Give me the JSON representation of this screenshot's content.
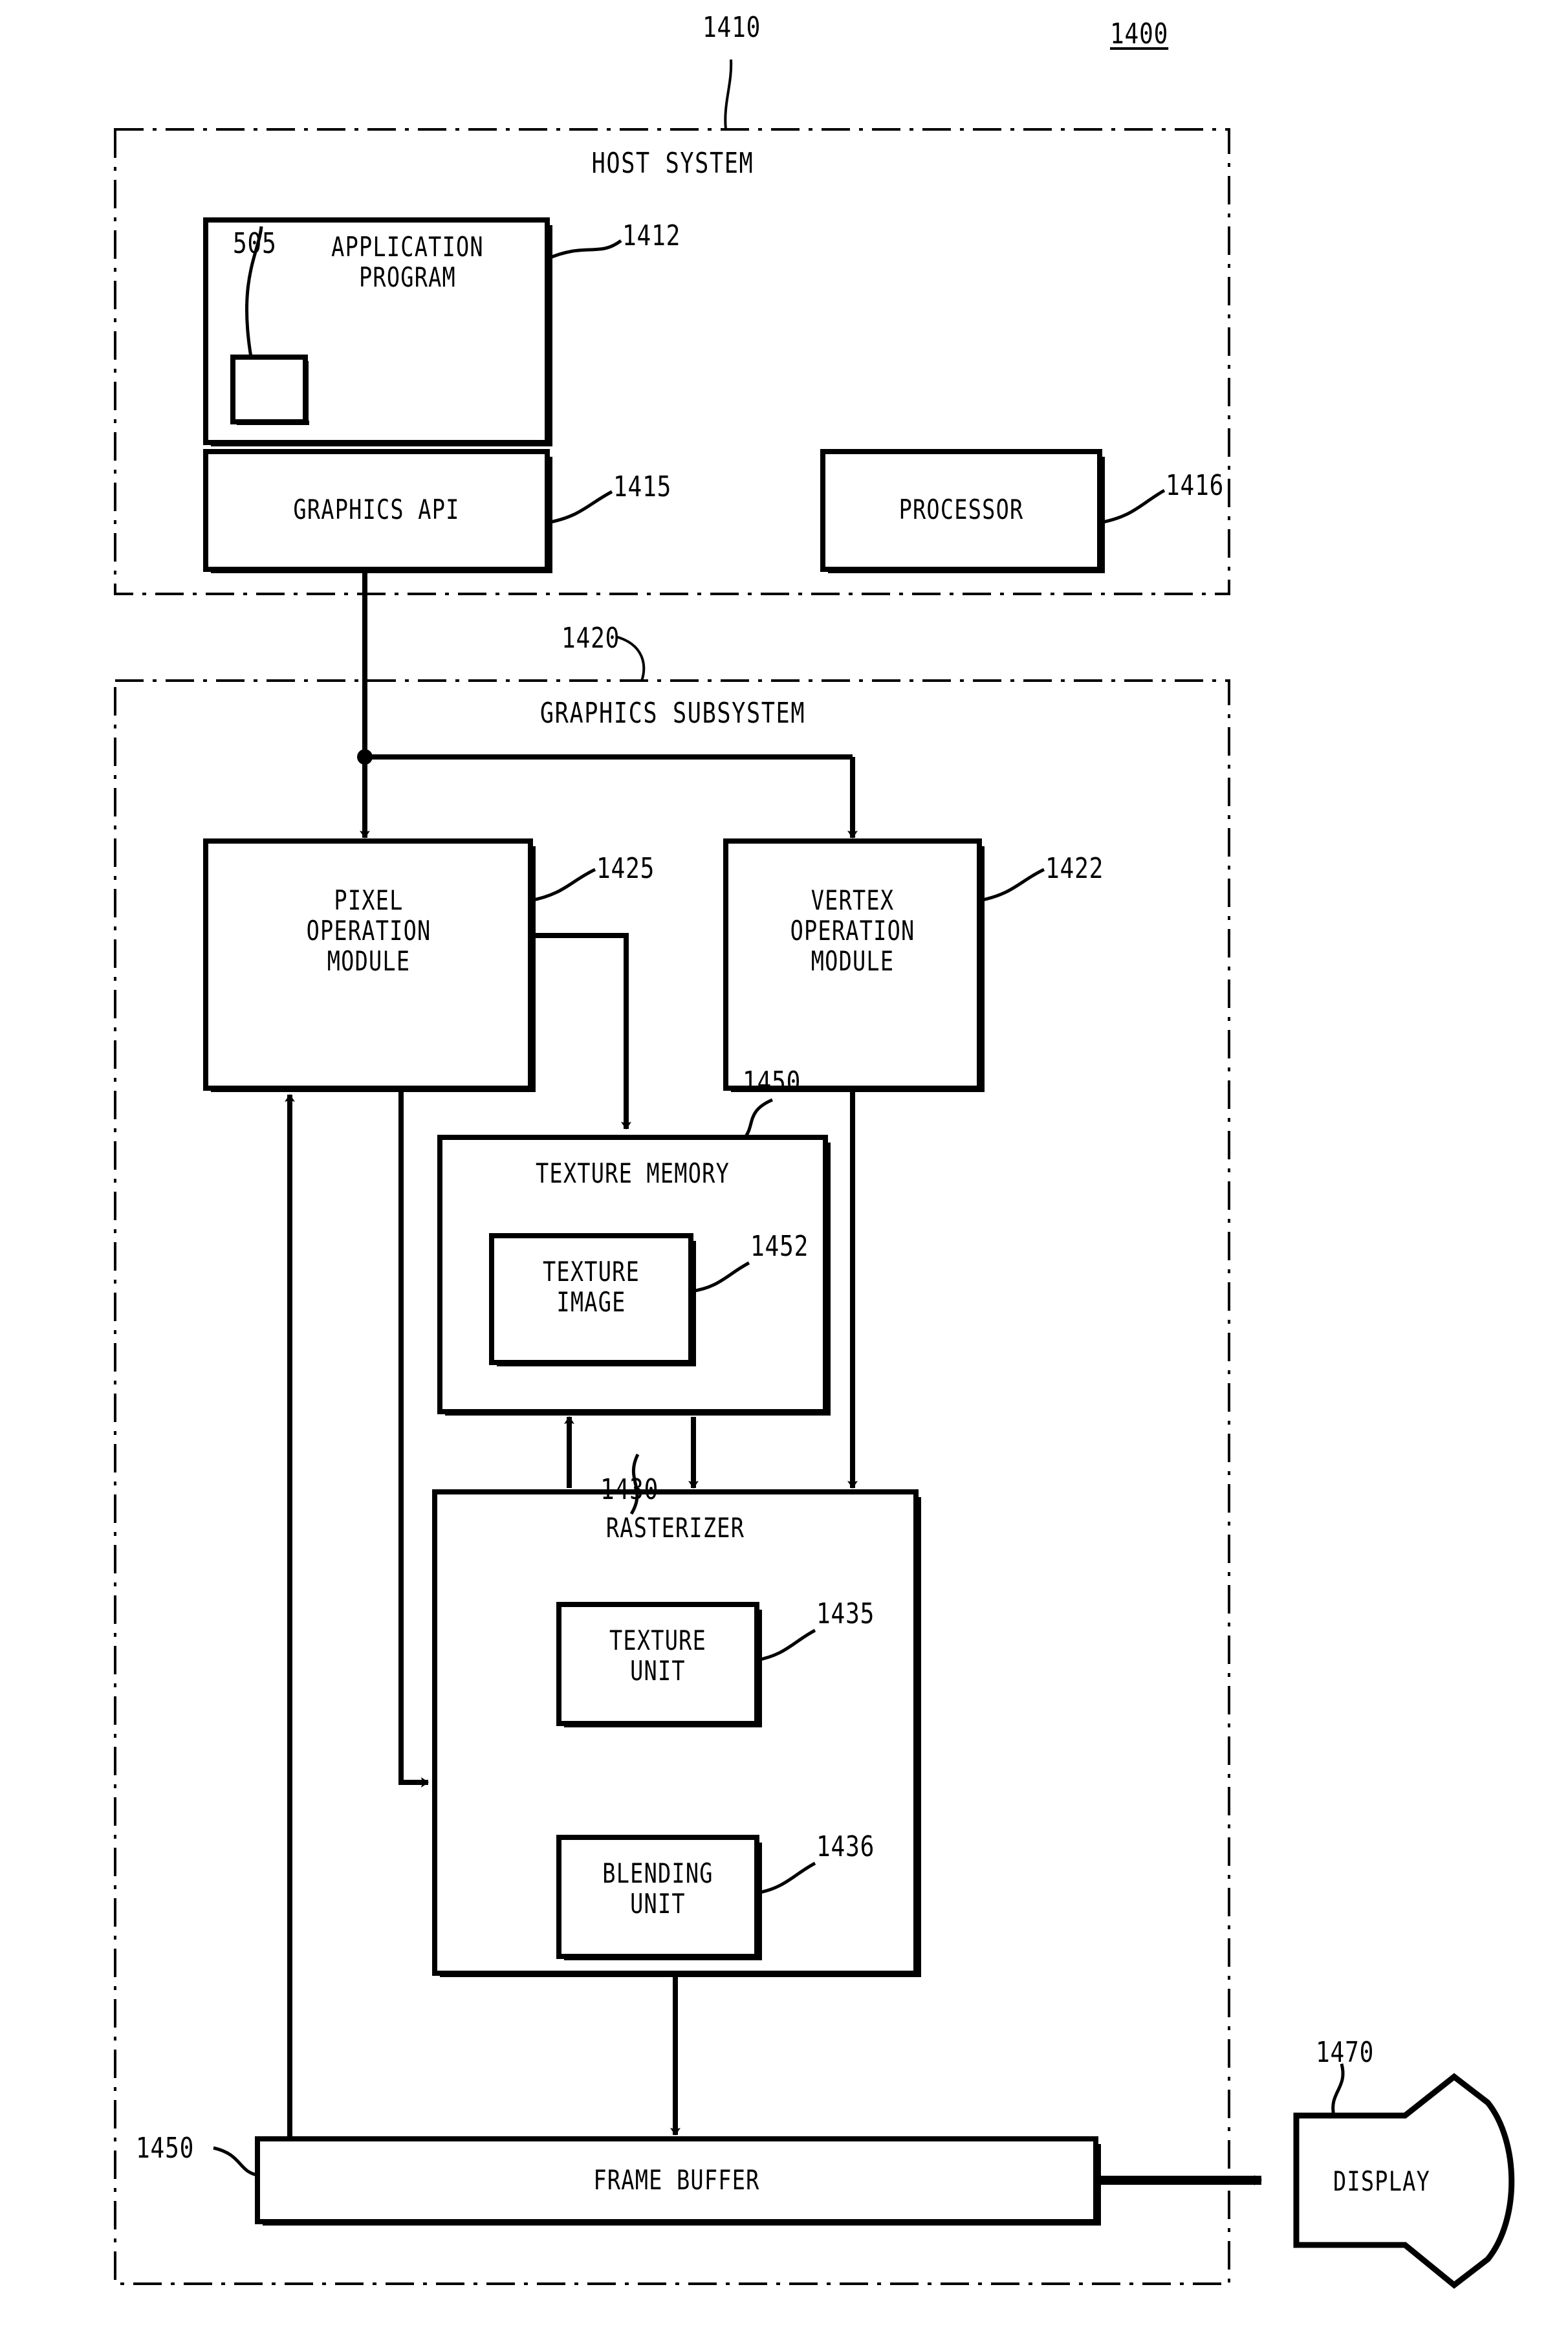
{
  "figure": {
    "figure_ref": "1400",
    "host_system": {
      "title": "HOST SYSTEM",
      "ref": "1410",
      "application_program": {
        "label": "APPLICATION\nPROGRAM",
        "ref": "1412",
        "inner_ref": "505"
      },
      "graphics_api": {
        "label": "GRAPHICS API",
        "ref": "1415"
      },
      "processor": {
        "label": "PROCESSOR",
        "ref": "1416"
      }
    },
    "graphics_subsystem": {
      "title": "GRAPHICS SUBSYSTEM",
      "ref": "1420",
      "pixel_operation_module": {
        "label": "PIXEL\nOPERATION\nMODULE",
        "ref": "1425"
      },
      "vertex_operation_module": {
        "label": "VERTEX\nOPERATION\nMODULE",
        "ref": "1422"
      },
      "texture_memory": {
        "label": "TEXTURE MEMORY",
        "ref": "1450",
        "texture_image": {
          "label": "TEXTURE\nIMAGE",
          "ref": "1452"
        }
      },
      "rasterizer": {
        "label": "RASTERIZER",
        "ref": "1430",
        "texture_unit": {
          "label": "TEXTURE\nUNIT",
          "ref": "1435"
        },
        "blending_unit": {
          "label": "BLENDING\nUNIT",
          "ref": "1436"
        }
      },
      "frame_buffer": {
        "label": "FRAME BUFFER",
        "ref": "1450"
      }
    },
    "display": {
      "label": "DISPLAY",
      "ref": "1470"
    }
  }
}
